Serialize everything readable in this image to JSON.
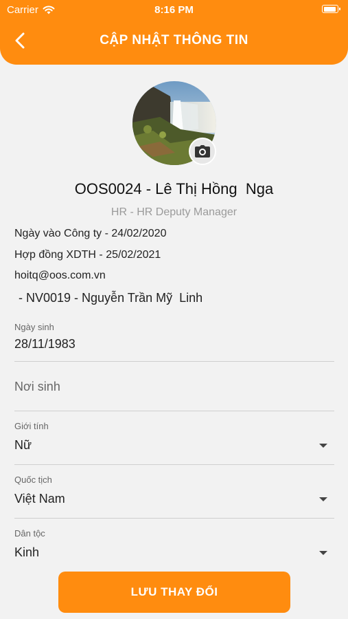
{
  "status_bar": {
    "carrier": "Carrier",
    "time": "8:16 PM"
  },
  "header": {
    "title": "CẬP NHẬT THÔNG TIN",
    "back_icon": "chevron-left-icon"
  },
  "profile": {
    "name": "OOS0024 - Lê Thị Hồng  Nga",
    "role": "HR - HR Deputy Manager",
    "join_date": "Ngày vào Công ty - 24/02/2020",
    "contract": "Hợp đồng XDTH - 25/02/2021",
    "email": "hoitq@oos.com.vn",
    "manager": " - NV0019 - Nguyễn Trần Mỹ  Linh"
  },
  "form": {
    "birth_date": {
      "label": "Ngày sinh",
      "value": "28/11/1983"
    },
    "birth_place": {
      "placeholder": "Nơi sinh"
    },
    "gender": {
      "label": "Giới tính",
      "value": "Nữ"
    },
    "nationality": {
      "label": "Quốc tịch",
      "value": "Việt Nam"
    },
    "ethnicity": {
      "label": "Dân tộc",
      "value": "Kinh"
    }
  },
  "save_button": {
    "label": "LƯU THAY ĐỔI"
  },
  "colors": {
    "accent": "#ff8c0f",
    "background": "#f2f2f2",
    "divider": "#cfcfcf"
  }
}
